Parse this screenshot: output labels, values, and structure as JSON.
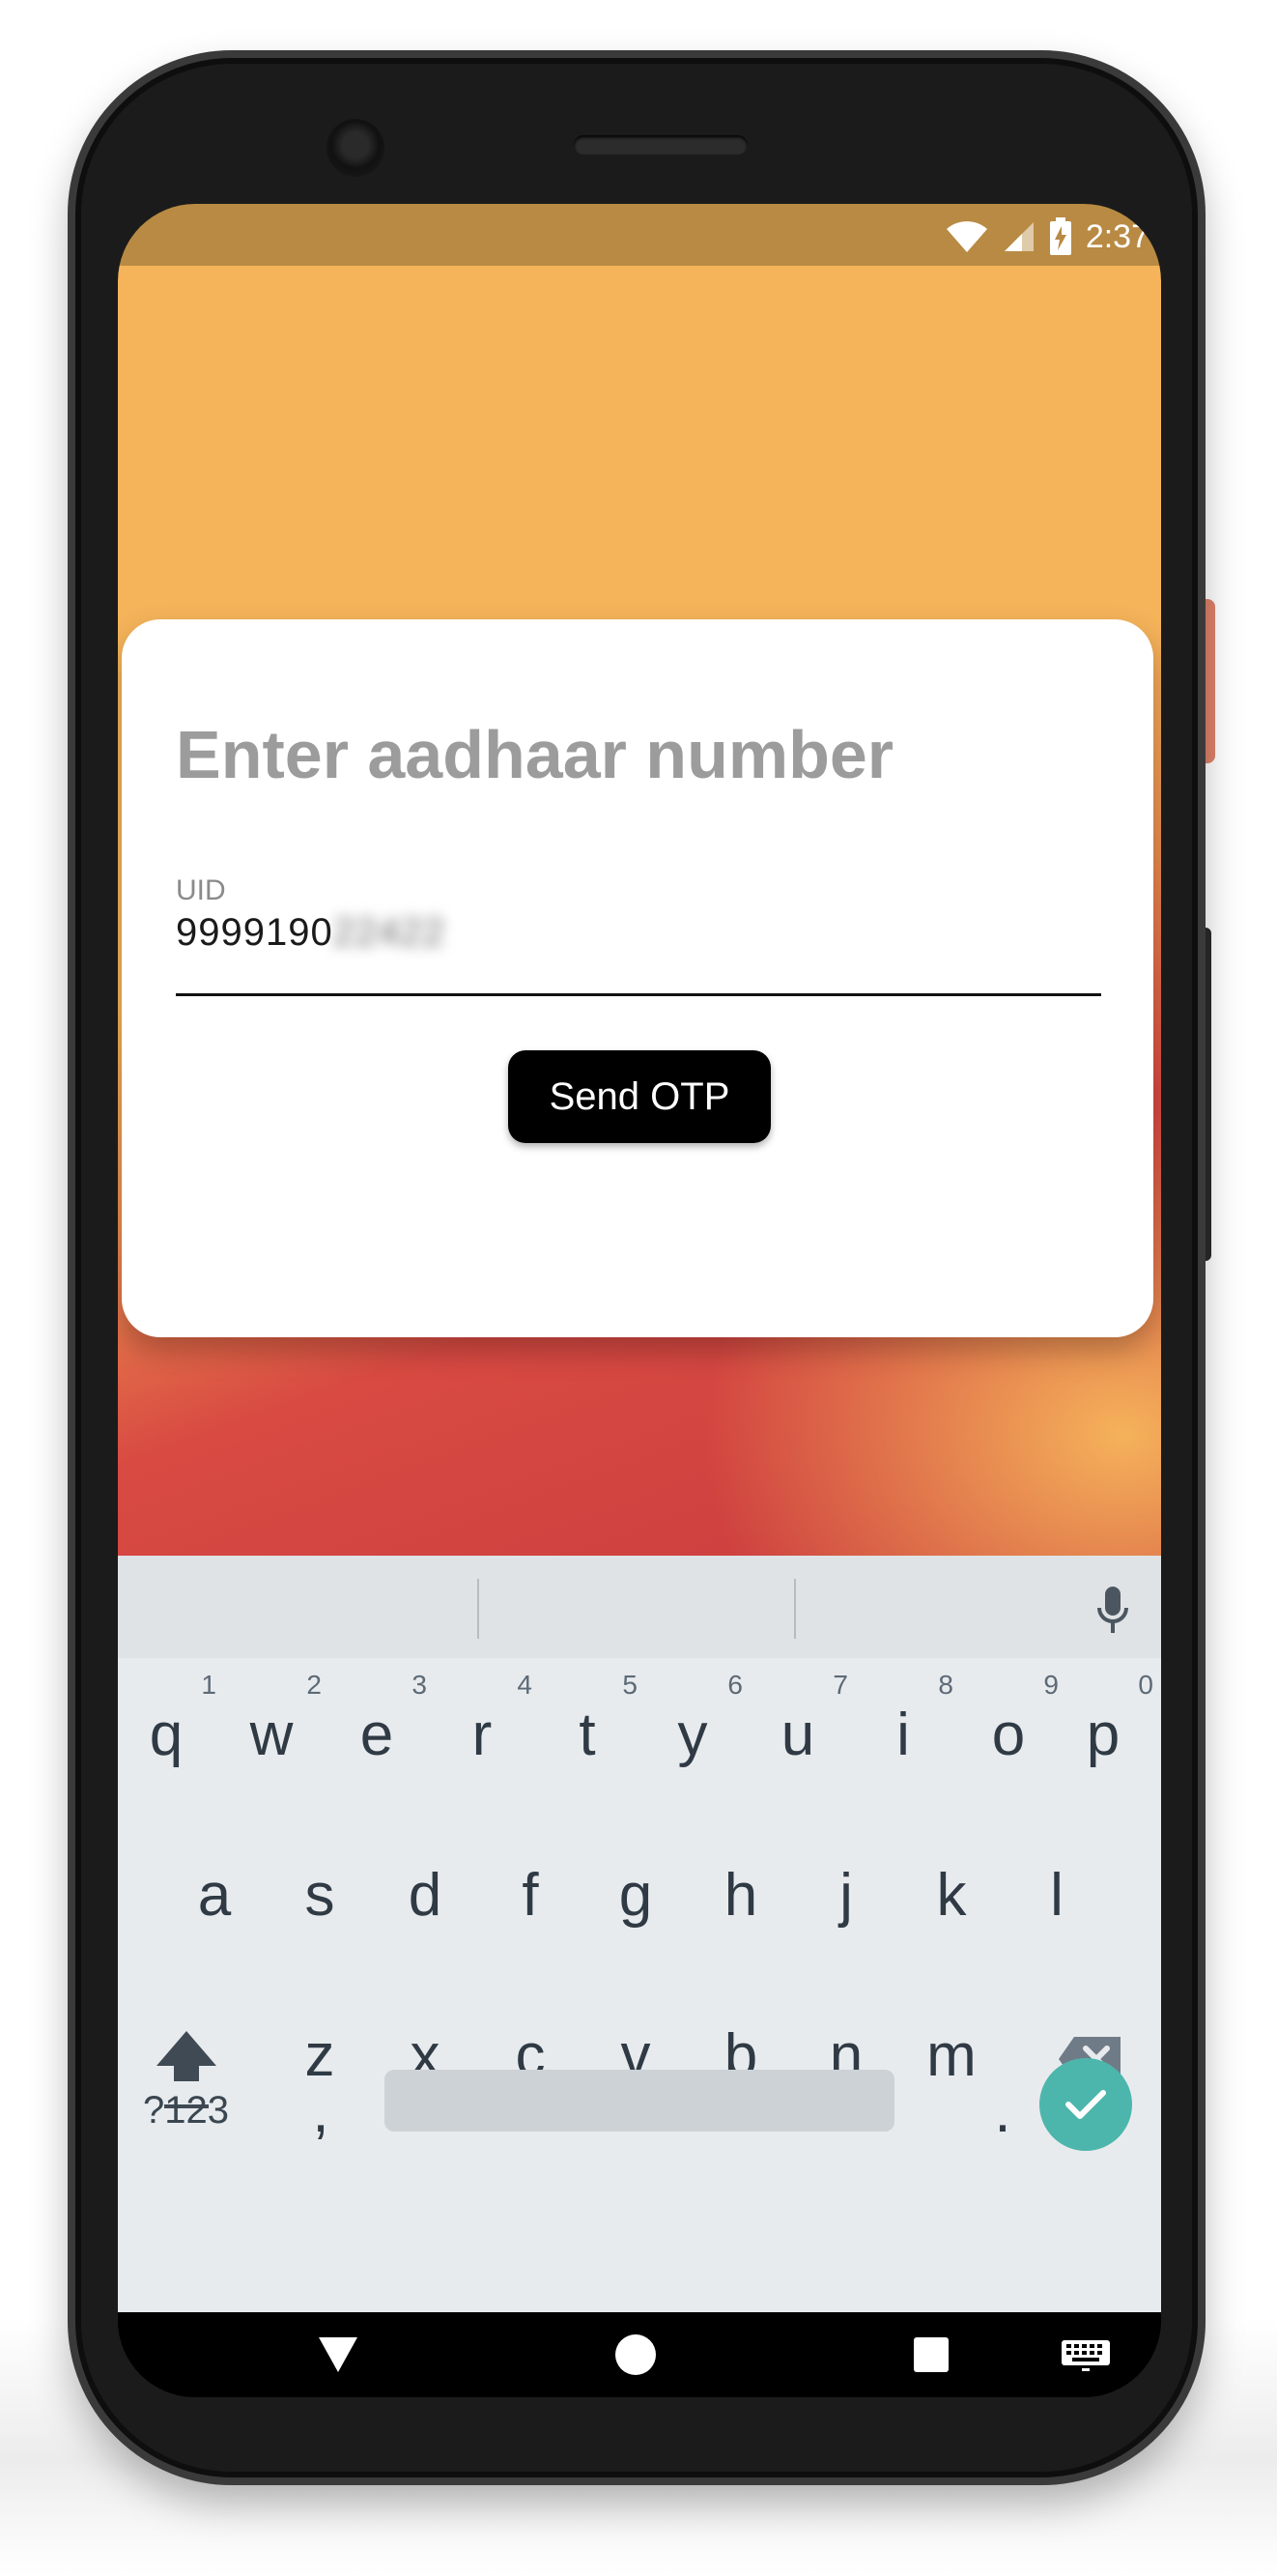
{
  "status_bar": {
    "time": "2:37"
  },
  "dialog": {
    "title": "Enter aadhaar number",
    "field_label": "UID",
    "field_value_visible": "9999190",
    "field_value_masked": "22422",
    "send_button_label": "Send OTP"
  },
  "keyboard": {
    "row1": [
      {
        "key": "q",
        "hint": "1"
      },
      {
        "key": "w",
        "hint": "2"
      },
      {
        "key": "e",
        "hint": "3"
      },
      {
        "key": "r",
        "hint": "4"
      },
      {
        "key": "t",
        "hint": "5"
      },
      {
        "key": "y",
        "hint": "6"
      },
      {
        "key": "u",
        "hint": "7"
      },
      {
        "key": "i",
        "hint": "8"
      },
      {
        "key": "o",
        "hint": "9"
      },
      {
        "key": "p",
        "hint": "0"
      }
    ],
    "row2": [
      "a",
      "s",
      "d",
      "f",
      "g",
      "h",
      "j",
      "k",
      "l"
    ],
    "row3": [
      "z",
      "x",
      "c",
      "v",
      "b",
      "n",
      "m"
    ],
    "symbols_key": "?123",
    "comma_key": ",",
    "period_key": "."
  },
  "icons": {
    "wifi": "wifi-icon",
    "signal": "signal-icon",
    "battery": "battery-charging-icon",
    "mic": "mic-icon",
    "shift": "shift-icon",
    "backspace": "backspace-icon",
    "enter": "check-icon",
    "nav_back": "back-triangle-icon",
    "nav_home": "home-circle-icon",
    "nav_recents": "recents-square-icon",
    "nav_keyboard": "keyboard-icon"
  },
  "colors": {
    "app_background_top": "#F5B45A",
    "app_background_bottom": "#C93C3E",
    "status_bar": "#B88A43",
    "card": "#FFFFFF",
    "button": "#000000",
    "enter_key": "#4DB6AC",
    "keyboard_bg": "#E8EBEE"
  }
}
